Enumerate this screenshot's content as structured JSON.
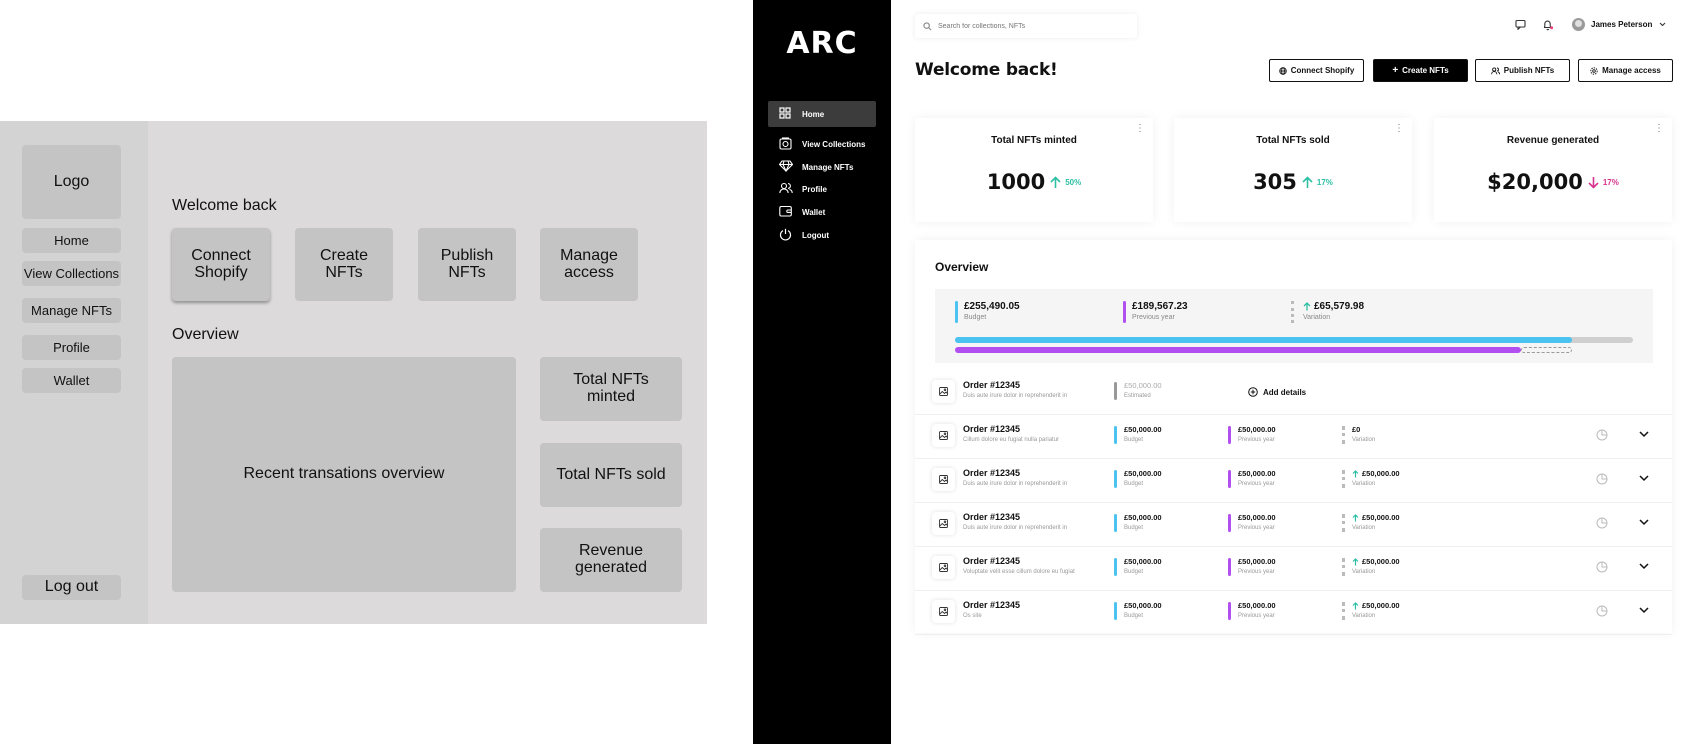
{
  "wireframe": {
    "logo": "Logo",
    "nav": [
      "Home",
      "View Collections",
      "Manage NFTs",
      "Profile",
      "Wallet"
    ],
    "logout": "Log out",
    "welcome": "Welcome back",
    "buttons": [
      "Connect\nShopify",
      "Create\nNFTs",
      "Publish\nNFTs",
      "Manage\naccess"
    ],
    "overview": "Overview",
    "recent": "Recent transations overview",
    "stats": [
      "Total NFTs\nminted",
      "Total NFTs sold",
      "Revenue\ngenerated"
    ]
  },
  "app": {
    "logo": "ARC",
    "nav": [
      {
        "label": "Home",
        "icon": "grid-icon"
      },
      {
        "label": "View Collections",
        "icon": "collection-icon"
      },
      {
        "label": "Manage NFTs",
        "icon": "diamond-icon"
      },
      {
        "label": "Profile",
        "icon": "users-icon"
      },
      {
        "label": "Wallet",
        "icon": "wallet-icon"
      },
      {
        "label": "Logout",
        "icon": "power-icon"
      }
    ],
    "search_placeholder": "Search for collections, NFTs",
    "user_name": "James Peterson",
    "welcome": "Welcome back!",
    "buttons": {
      "connect_shopify": "Connect Shopify",
      "create_nfts": "Create NFTs",
      "publish_nfts": "Publish NFTs",
      "manage_access": "Manage access"
    },
    "cards": [
      {
        "title": "Total NFTs minted",
        "value": "1000",
        "change": "50%",
        "direction": "up",
        "color": "#2dbfa4"
      },
      {
        "title": "Total NFTs sold",
        "value": "305",
        "change": "17%",
        "direction": "up",
        "color": "#2dbfa4"
      },
      {
        "title": "Revenue generated",
        "value": "$20,000",
        "change": "17%",
        "direction": "down",
        "color": "#d6338c"
      }
    ],
    "overview": {
      "title": "Overview",
      "budget": {
        "value": "£255,490.05",
        "label": "Budget"
      },
      "previous": {
        "value": "£189,567.23",
        "label": "Previous year"
      },
      "variation": {
        "value": "£65,579.98",
        "label": "Variation"
      },
      "budget_progress": 0.91,
      "previous_progress": 0.835,
      "colors": {
        "budget": "#4bc3f0",
        "previous": "#b14ff0",
        "variation": "#cfcfcf",
        "up": "#2dbfa4"
      }
    },
    "first_row": {
      "title": "Order #12345",
      "subtitle": "Duis aute irure dolor in reprehenderit in",
      "value": "£50,000.00",
      "label": "Estimated",
      "add": "Add details"
    },
    "rows": [
      {
        "title": "Order #12345",
        "subtitle": "Cillum dolore eu fugiat nulla pariatur",
        "budget": "£50,000.00",
        "budget_label": "Budget",
        "previous": "£50,000.00",
        "previous_label": "Previous year",
        "variation": "£0",
        "variation_label": "Variation",
        "arrow": false
      },
      {
        "title": "Order #12345",
        "subtitle": "Duis aute irure dolor in reprehenderit in",
        "budget": "£50,000.00",
        "budget_label": "Budget",
        "previous": "£50,000.00",
        "previous_label": "Previous year",
        "variation": "£50,000.00",
        "variation_label": "Variation",
        "arrow": true
      },
      {
        "title": "Order #12345",
        "subtitle": "Duis aute irure dolor in reprehenderit in",
        "budget": "£50,000.00",
        "budget_label": "Budget",
        "previous": "£50,000.00",
        "previous_label": "Previous year",
        "variation": "£50,000.00",
        "variation_label": "Variation",
        "arrow": true
      },
      {
        "title": "Order #12345",
        "subtitle": "Voluptate velit esse cillum dolore eu fugiat",
        "budget": "£50,000.00",
        "budget_label": "Budget",
        "previous": "£50,000.00",
        "previous_label": "Previous year",
        "variation": "£50,000.00",
        "variation_label": "Variation",
        "arrow": true
      },
      {
        "title": "Order #12345",
        "subtitle": "Os site",
        "budget": "£50,000.00",
        "budget_label": "Budget",
        "previous": "£50,000.00",
        "previous_label": "Previous year",
        "variation": "£50,000.00",
        "variation_label": "Variation",
        "arrow": true
      }
    ]
  }
}
